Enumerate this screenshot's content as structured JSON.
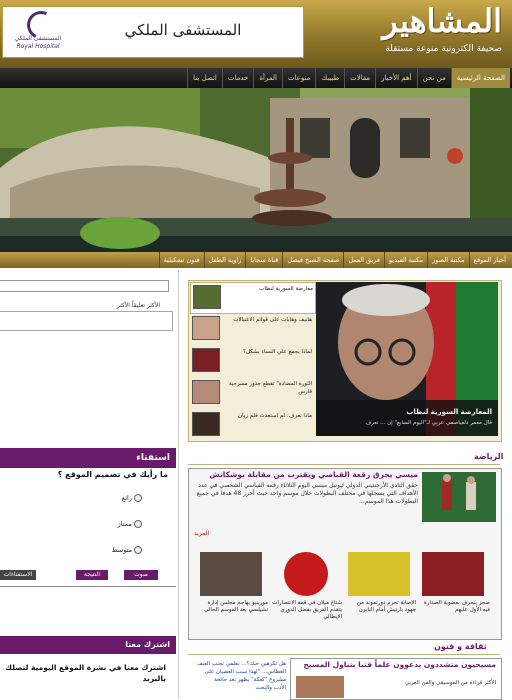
{
  "header": {
    "site_title": "المشاهير",
    "site_subtitle": "صحيفة الكترونية منوعة مستقلة",
    "ad_text": "المستشفى الملكي",
    "ad_logo_line1": "المستشفى الملكي",
    "ad_logo_line2": "Royal Hospital"
  },
  "nav": {
    "items": [
      "الصفحة الرئيسية",
      "من نحن",
      "أهم الأخبار",
      "مقالات",
      "طبيبك",
      "منوعات",
      "المرأة",
      "خدمات",
      "اتصل بنا"
    ]
  },
  "subnav": {
    "items": [
      "أخبار الموقع",
      "مكتبة الصور",
      "مكتبة الفيديو",
      "فريق العمل",
      "صفحة الشيخ فيصل",
      "قناة سجايا",
      "زاوية الطفل",
      "فنون تشكيلية"
    ]
  },
  "left": {
    "comment_tabs": "الأكثر تعليقاً    الأكثر",
    "poll_title": "استفتاء",
    "poll_question": "ما رأيك في تصميم الموقع ؟",
    "poll_options": [
      "رائع",
      "ممتاز",
      "متوسط"
    ],
    "poll_results_btn": "الاستفتاءات",
    "poll_vote_btn": "صوت",
    "poll_result_btn": "النتيجة",
    "subscribe_title": "اشترك معنا",
    "subscribe_text": "اشترك معنا في نشرة الموقع اليومية لتصلك بالبريد"
  },
  "featured": {
    "items": [
      "معارضة السورية لنظاب",
      "هانيف وهابات على قوائم الاغتيالات",
      "لماذا يجمع علي النساء بشكل؟",
      "الثورة المضادة\" تقطع جذور مسرحية قارس",
      "ماذا نعرف: لم استعدت فلم زيان"
    ],
    "caption_title": "المعارضة السورية لنظاب",
    "caption_text": "قال معمر دلعياصمي عربي لـ\"اليوم السابع\" إن ... تعرف"
  },
  "sports": {
    "title": "الرياضة",
    "headline": "ميسي يحرق رقعة القباصي ويقترب من مقابلة بوشكاتش",
    "body": "حقق النادي الأرجنتيني الدولي ليونيل ميسي اليوم الثلاثاء رقمه القياسي الشخصي في عدد الأهداف التي يسجلها في مختلف البطولات خلال موسم واحد حيث أحرز 48 هدفا في جميع البطولات هذا الموسم...",
    "more": "المزيد",
    "cards": [
      "ضجر ينحرف بعضوية الصدارة فيه الأول عليهم",
      "الإصابة تحرم دورتموند من جهود بارتيش أمام البايرن",
      "شتاغ ميلان في قمة الانتصارات يتقدم الفريق بفضل الدوري الإيطالي",
      "مورينيو يهاجم مجلس إدارة تشيلسي بعد الموسم الحالي"
    ]
  },
  "culture": {
    "title": "ثقافة و فنون",
    "headline": "مسيحيون متشددون يدعوون علماً قتيا بتناول المسيح",
    "body": "الأكثر قراءة من الموسيقى والفن العربي",
    "list": [
      "هل تكرهين حبك؟... تعلمي تجنب العنف",
      "الغطاس... \"لهذا سبب العصيان على مشروع \"كعكة\" يظهر بعد جائحة",
      "الأدب والبحث"
    ]
  },
  "colors": {
    "gold": "#b89a3c",
    "purple": "#6a1a6a",
    "nav_dark": "#1a1a1a"
  }
}
